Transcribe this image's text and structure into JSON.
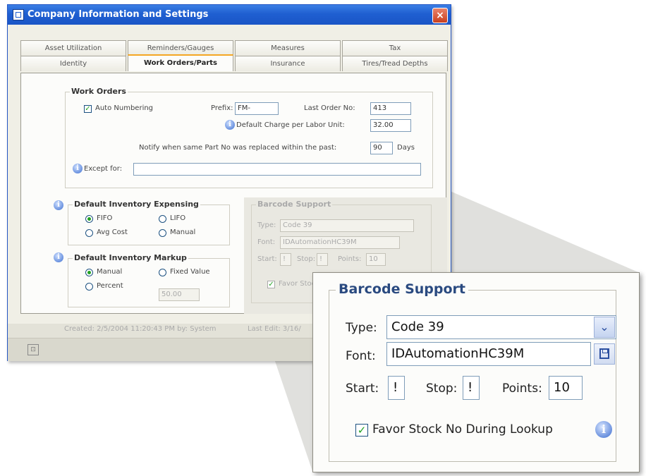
{
  "window": {
    "title": "Company Information and Settings",
    "close_glyph": "×"
  },
  "tabs": {
    "row1": [
      "Asset Utilization",
      "Reminders/Gauges",
      "Measures",
      "Tax"
    ],
    "row2": [
      "Identity",
      "Work Orders/Parts",
      "Insurance",
      "Tires/Tread Depths"
    ],
    "active": "Work Orders/Parts"
  },
  "work_orders": {
    "legend": "Work Orders",
    "auto_numbering_label": "Auto Numbering",
    "auto_numbering_checked": true,
    "prefix_label": "Prefix:",
    "prefix_value": "FM-",
    "last_order_label": "Last Order No:",
    "last_order_value": "413",
    "charge_label": "Default Charge per Labor Unit:",
    "charge_value": "32.00",
    "notify_label": "Notify when same Part No was replaced within the past:",
    "notify_value": "90",
    "days_label": "Days",
    "except_label": "Except for:",
    "except_value": ""
  },
  "expensing": {
    "legend": "Default Inventory Expensing",
    "fifo": "FIFO",
    "lifo": "LIFO",
    "avg_cost": "Avg Cost",
    "manual": "Manual",
    "selected": "FIFO"
  },
  "markup": {
    "legend": "Default Inventory Markup",
    "manual": "Manual",
    "fixed_value": "Fixed Value",
    "percent": "Percent",
    "percent_value": "50.00",
    "selected": "Manual"
  },
  "barcode_small": {
    "legend": "Barcode Support",
    "type_label": "Type:",
    "type_value": "Code 39",
    "font_label": "Font:",
    "font_value": "IDAutomationHC39M",
    "start_label": "Start:",
    "start_value": "!",
    "stop_label": "Stop:",
    "stop_value": "!",
    "points_label": "Points:",
    "points_value": "10",
    "favor_label": "Favor Stoc"
  },
  "status": {
    "created": "Created: 2/5/2004 11:20:43 PM by: System",
    "last_edit": "Last Edit: 3/16/"
  },
  "zoom": {
    "legend": "Barcode Support",
    "type_label": "Type:",
    "type_value": "Code 39",
    "font_label": "Font:",
    "font_value": "IDAutomationHC39M",
    "start_label": "Start:",
    "start_value": "!",
    "stop_label": "Stop:",
    "stop_value": "!",
    "points_label": "Points:",
    "points_value": "10",
    "favor_label": "Favor Stock No During Lookup",
    "favor_checked": true
  },
  "icons": {
    "info": "info-icon",
    "dropdown": "chevron-down-icon",
    "font_picker": "save-icon",
    "window": "window-icon"
  },
  "colors": {
    "title_bar": "#1f5fd1",
    "active_tab_accent": "#f4a623",
    "check_green": "#21a121",
    "legend_blue": "#2a4a80"
  }
}
